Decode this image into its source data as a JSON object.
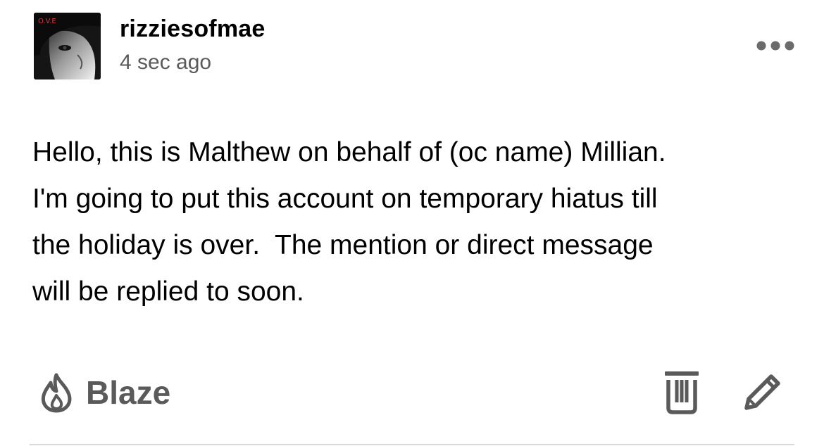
{
  "post": {
    "author": {
      "username": "rizziesofmae",
      "avatar_caption": "O.V.E"
    },
    "timestamp": "4 sec ago",
    "body": "Hello, this is Malthew on behalf of (oc name) Millian.\nI'm going to put this account on temporary hiatus till\nthe holiday is over.  The mention or direct message\nwill be replied to soon.",
    "actions": {
      "blaze_label": "Blaze",
      "blaze_icon": "flame-icon",
      "delete_icon": "trash-icon",
      "edit_icon": "pencil-icon",
      "more_icon": "more-horizontal-icon"
    }
  },
  "colors": {
    "text_primary": "#000000",
    "text_secondary": "#5a5a5a",
    "divider": "#d9d9d9",
    "avatar_caption": "#d43a3a"
  }
}
